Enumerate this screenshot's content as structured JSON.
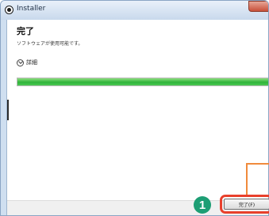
{
  "window": {
    "title": "Installer"
  },
  "content": {
    "heading": "完了",
    "subtext": "ソフトウェアが使用可能です。",
    "details_label": "詳細"
  },
  "progress": {
    "value_percent": 100,
    "color": "#2fb33a"
  },
  "buttons": {
    "finish_label": "完了(F)"
  },
  "annotation": {
    "step_number": "1",
    "highlight_color": "#e8402c",
    "callout_color": "#f08a3c",
    "badge_color": "#1d9e74"
  }
}
